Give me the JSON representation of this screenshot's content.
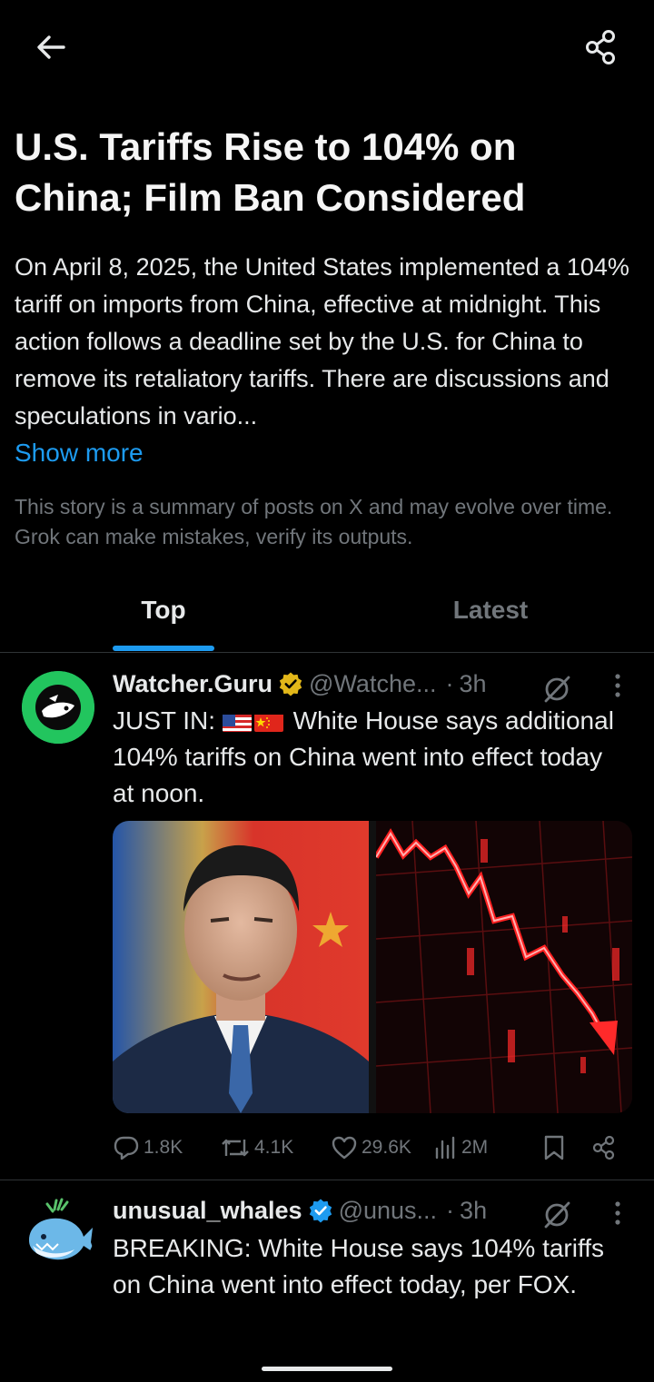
{
  "header": {
    "back_icon": "arrow-left-icon",
    "share_icon": "share-icon"
  },
  "story": {
    "title": "U.S. Tariffs Rise to 104% on China; Film Ban Considered",
    "body": "On April 8, 2025, the United States implemented a 104% tariff on imports from China, effective at midnight. This action follows a deadline set by the U.S. for China to remove its retaliatory tariffs. There are discussions and speculations in vario...",
    "show_more": "Show more",
    "disclaimer": "This story is a summary of posts on X and may evolve over time. Grok can make mistakes, verify its outputs."
  },
  "tabs": [
    {
      "label": "Top",
      "active": true
    },
    {
      "label": "Latest",
      "active": false
    }
  ],
  "tweets": [
    {
      "name": "Watcher.Guru",
      "verified_color": "#e2b719",
      "handle": "@Watche...",
      "time": "3h",
      "text_prefix": "JUST IN:",
      "text_rest": " White House says additional 104% tariffs on China went into effect today at noon.",
      "flags": [
        "us-flag",
        "china-flag"
      ],
      "stats": {
        "replies": "1.8K",
        "reposts": "4.1K",
        "likes": "29.6K",
        "views": "2M"
      }
    },
    {
      "name": "unusual_whales",
      "verified_color": "#1d9bf0",
      "handle": "@unus...",
      "time": "3h",
      "text": "BREAKING: White House says 104% tariffs on China went into effect today, per FOX."
    }
  ],
  "colors": {
    "accent": "#1d9bf0",
    "muted": "#71767b",
    "background": "#000000"
  }
}
